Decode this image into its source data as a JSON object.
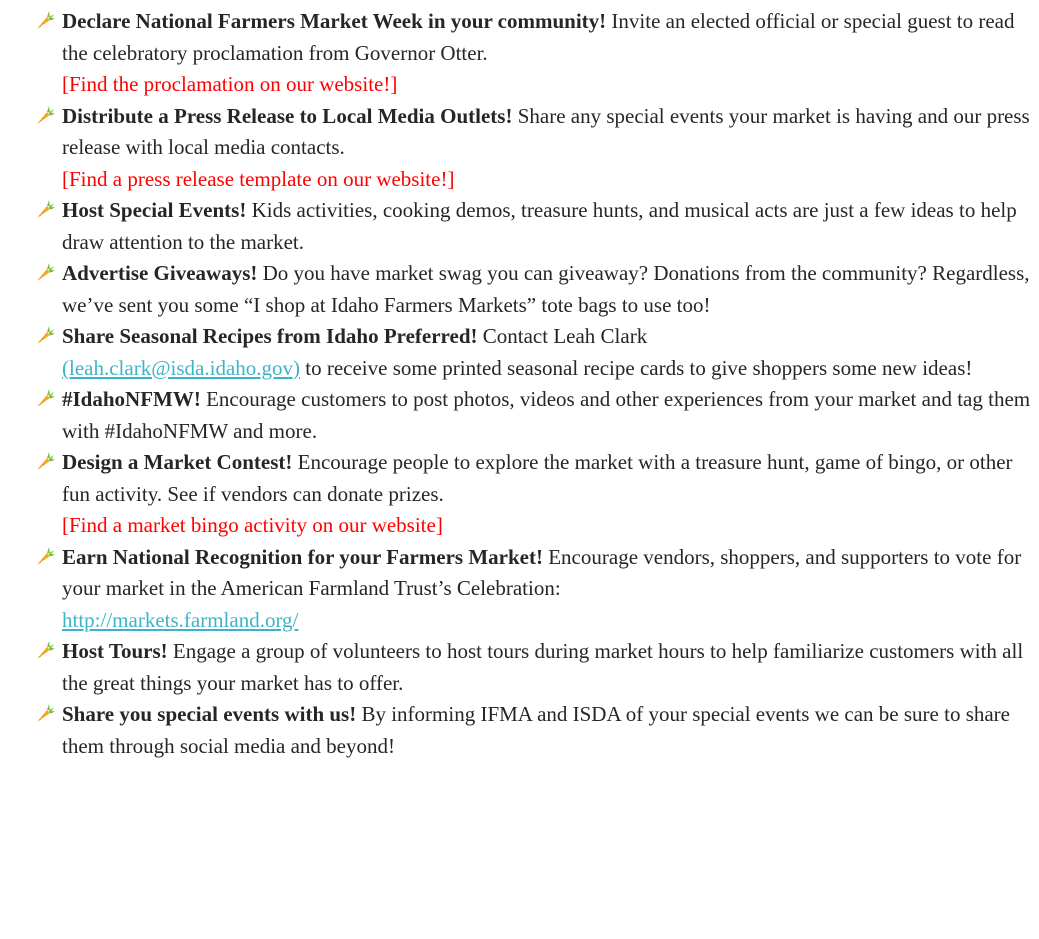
{
  "colors": {
    "text": "#262626",
    "red_note": "#ff0000",
    "link": "#3db3c8",
    "carrot_orange": "#f5a623",
    "carrot_green": "#7cc242"
  },
  "bullet_icon": "carrot-icon",
  "items": [
    {
      "title": "Declare National Farmers Market Week in your community!",
      "text": "Invite an elected official or special guest to read the celebratory proclamation from Governor Otter.",
      "note": "[Find the proclamation on our website!]"
    },
    {
      "title": "Distribute a Press Release to Local Media Outlets!",
      "text": "Share any special events your market is having and our press release with local media contacts.",
      "note": "[Find a press release template on our website!]"
    },
    {
      "title": "Host Special Events!",
      "text": "Kids activities, cooking demos, treasure hunts, and musical acts are just a few ideas to help draw attention to the market."
    },
    {
      "title": "Advertise Giveaways!",
      "text": "Do you have market swag you can giveaway? Donations from the community? Regardless, we’ve sent you some “I shop at Idaho Farmers Markets” tote bags to use too!"
    },
    {
      "title": "Share Seasonal Recipes from Idaho  Preferred!",
      "text_before_link": "Contact Leah Clark",
      "link": "(leah.clark@isda.idaho.gov)",
      "text_after_link": "to receive some printed seasonal recipe cards to give shoppers some new ideas!"
    },
    {
      "title": "#IdahoNFMW!",
      "text": "Encourage customers to post photos, videos and other experiences  from your market and tag them with #IdahoNFMW and more."
    },
    {
      "title": "Design a Market Contest!",
      "text": "Encourage people to explore the market with a treasure hunt, game of bingo, or other fun activity. See if vendors can donate prizes.",
      "note": "[Find a market  bingo activity on our website]"
    },
    {
      "title": "Earn National Recognition for your Farmers  Market!",
      "text": "Encourage vendors, shoppers, and supporters to vote for your market  in the American Farmland Trust’s Celebration:",
      "link": "http://markets.farmland.org/"
    },
    {
      "title": "Host Tours!",
      "text": "Engage a group of volunteers to host tours during market hours to help familiarize  customers with all the great things your market has to offer."
    },
    {
      "title": "Share you special events with us!",
      "text": "By informing IFMA and ISDA of your special events we can be sure to share them through social media and beyond!"
    }
  ]
}
